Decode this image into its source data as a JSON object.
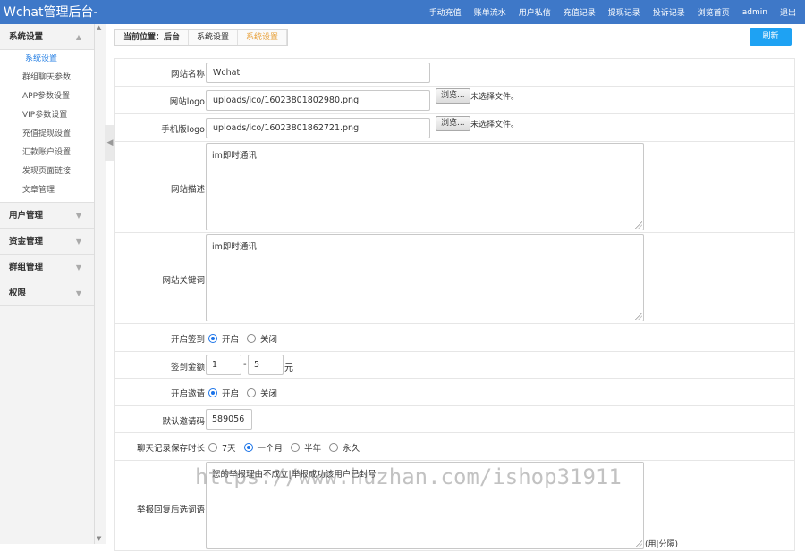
{
  "header": {
    "title": "Wchat管理后台-",
    "nav": [
      "手动充值",
      "账单流水",
      "用户私信",
      "充值记录",
      "提现记录",
      "投诉记录",
      "浏览首页",
      "admin",
      "退出"
    ]
  },
  "sidebar": {
    "sections": [
      {
        "label": "系统设置",
        "expanded": true,
        "items": [
          "系统设置",
          "群组聊天参数",
          "APP参数设置",
          "VIP参数设置",
          "充值提现设置",
          "汇款账户设置",
          "发现页面链接",
          "文章管理"
        ]
      },
      {
        "label": "用户管理",
        "expanded": false
      },
      {
        "label": "资金管理",
        "expanded": false
      },
      {
        "label": "群组管理",
        "expanded": false
      },
      {
        "label": "权限",
        "expanded": false
      }
    ],
    "active_item": "系统设置"
  },
  "breadcrumb": {
    "items": [
      "当前位置：后台",
      "系统设置",
      "系统设置"
    ]
  },
  "refresh_label": "刷新",
  "form": {
    "site_name": {
      "label": "网站名称",
      "value": "Wchat"
    },
    "site_logo": {
      "label": "网站logo",
      "value": "uploads/ico/16023801802980.png",
      "browse": "浏览...",
      "nofile": "未选择文件。"
    },
    "mobile_logo": {
      "label": "手机版logo",
      "value": "uploads/ico/16023801862721.png",
      "browse": "浏览...",
      "nofile": "未选择文件。"
    },
    "site_desc": {
      "label": "网站描述",
      "value": "im即时通讯"
    },
    "site_keywords": {
      "label": "网站关键词",
      "value": "im即时通讯"
    },
    "checkin": {
      "label": "开启签到",
      "options": [
        "开启",
        "关闭"
      ],
      "selected": "开启"
    },
    "checkin_amount": {
      "label": "签到金额",
      "min": "1",
      "sep": "-",
      "max": "5",
      "unit": "元"
    },
    "invite": {
      "label": "开启邀请",
      "options": [
        "开启",
        "关闭"
      ],
      "selected": "开启"
    },
    "invite_code": {
      "label": "默认邀请码",
      "value": "589056"
    },
    "chat_retention": {
      "label": "聊天记录保存时长",
      "options": [
        "7天",
        "一个月",
        "半年",
        "永久"
      ],
      "selected": "一个月"
    },
    "report_reply": {
      "label": "举报回复后选词语",
      "value": "您的举报理由不成立|举报成功该用户已封号",
      "note": "(用|分隔)"
    }
  },
  "watermark": "https://www.huzhan.com/ishop31911",
  "colors": {
    "topbar": "#3e78c8",
    "accent": "#2a82e4",
    "refresh": "#1ea2f3",
    "crumb_current": "#e8a13b"
  }
}
